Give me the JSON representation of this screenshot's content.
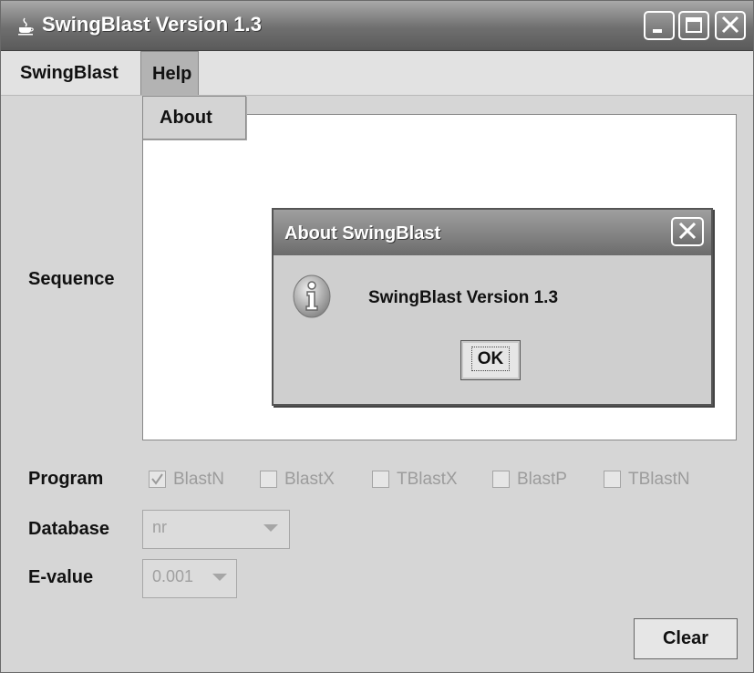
{
  "window": {
    "title": "SwingBlast Version 1.3"
  },
  "menubar": {
    "items": [
      "SwingBlast",
      "Help"
    ]
  },
  "help_menu": {
    "items": [
      "About"
    ]
  },
  "form": {
    "sequence_label": "Sequence",
    "program_label": "Program",
    "programs": [
      {
        "label": "BlastN",
        "checked": true
      },
      {
        "label": "BlastX",
        "checked": false
      },
      {
        "label": "TBlastX",
        "checked": false
      },
      {
        "label": "BlastP",
        "checked": false
      },
      {
        "label": "TBlastN",
        "checked": false
      }
    ],
    "database_label": "Database",
    "database_value": "nr",
    "evalue_label": "E-value",
    "evalue_value": "0.001",
    "clear_label": "Clear"
  },
  "about_dialog": {
    "title": "About SwingBlast",
    "message": "SwingBlast Version 1.3",
    "ok_label": "OK",
    "icon": "info-icon"
  },
  "icons": {
    "app": "java-cup-icon",
    "minimize": "minimize-icon",
    "maximize": "maximize-icon",
    "close": "close-icon"
  }
}
